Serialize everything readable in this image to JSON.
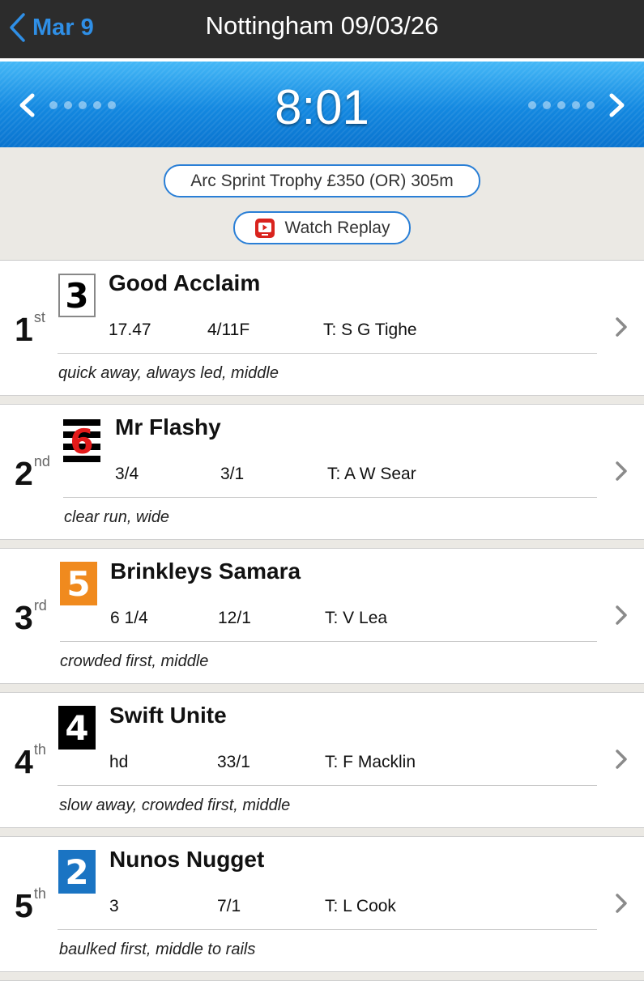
{
  "nav": {
    "back_label": "Mar 9",
    "title": "Nottingham 09/03/26"
  },
  "race": {
    "time": "8:01",
    "description": "Arc Sprint Trophy £350 (OR) 305m",
    "replay_label": "Watch Replay"
  },
  "colors": {
    "accent": "#2f8fe6",
    "time_bar": "#1388e0",
    "pill_border": "#2a7fd6",
    "replay_icon": "#d9231d"
  },
  "results": [
    {
      "position": "1",
      "suffix": "st",
      "trap": "3",
      "trap_style": "t3",
      "name": "Good Acclaim",
      "time": "17.47",
      "odds": "4/11F",
      "trainer": "T: S G Tighe",
      "comment": "quick away, always led, middle"
    },
    {
      "position": "2",
      "suffix": "nd",
      "trap": "6",
      "trap_style": "t6",
      "name": "Mr Flashy",
      "time": "3/4",
      "odds": "3/1",
      "trainer": "T: A W Sear",
      "comment": "clear run, wide"
    },
    {
      "position": "3",
      "suffix": "rd",
      "trap": "5",
      "trap_style": "t5",
      "name": "Brinkleys Samara",
      "time": "6 1/4",
      "odds": "12/1",
      "trainer": "T: V Lea",
      "comment": "crowded first, middle"
    },
    {
      "position": "4",
      "suffix": "th",
      "trap": "4",
      "trap_style": "t4",
      "name": "Swift Unite",
      "time": "hd",
      "odds": "33/1",
      "trainer": "T: F Macklin",
      "comment": "slow away, crowded first, middle"
    },
    {
      "position": "5",
      "suffix": "th",
      "trap": "2",
      "trap_style": "t2",
      "name": "Nunos Nugget",
      "time": "3",
      "odds": "7/1",
      "trainer": "T: L Cook",
      "comment": "baulked first, middle to rails"
    }
  ]
}
